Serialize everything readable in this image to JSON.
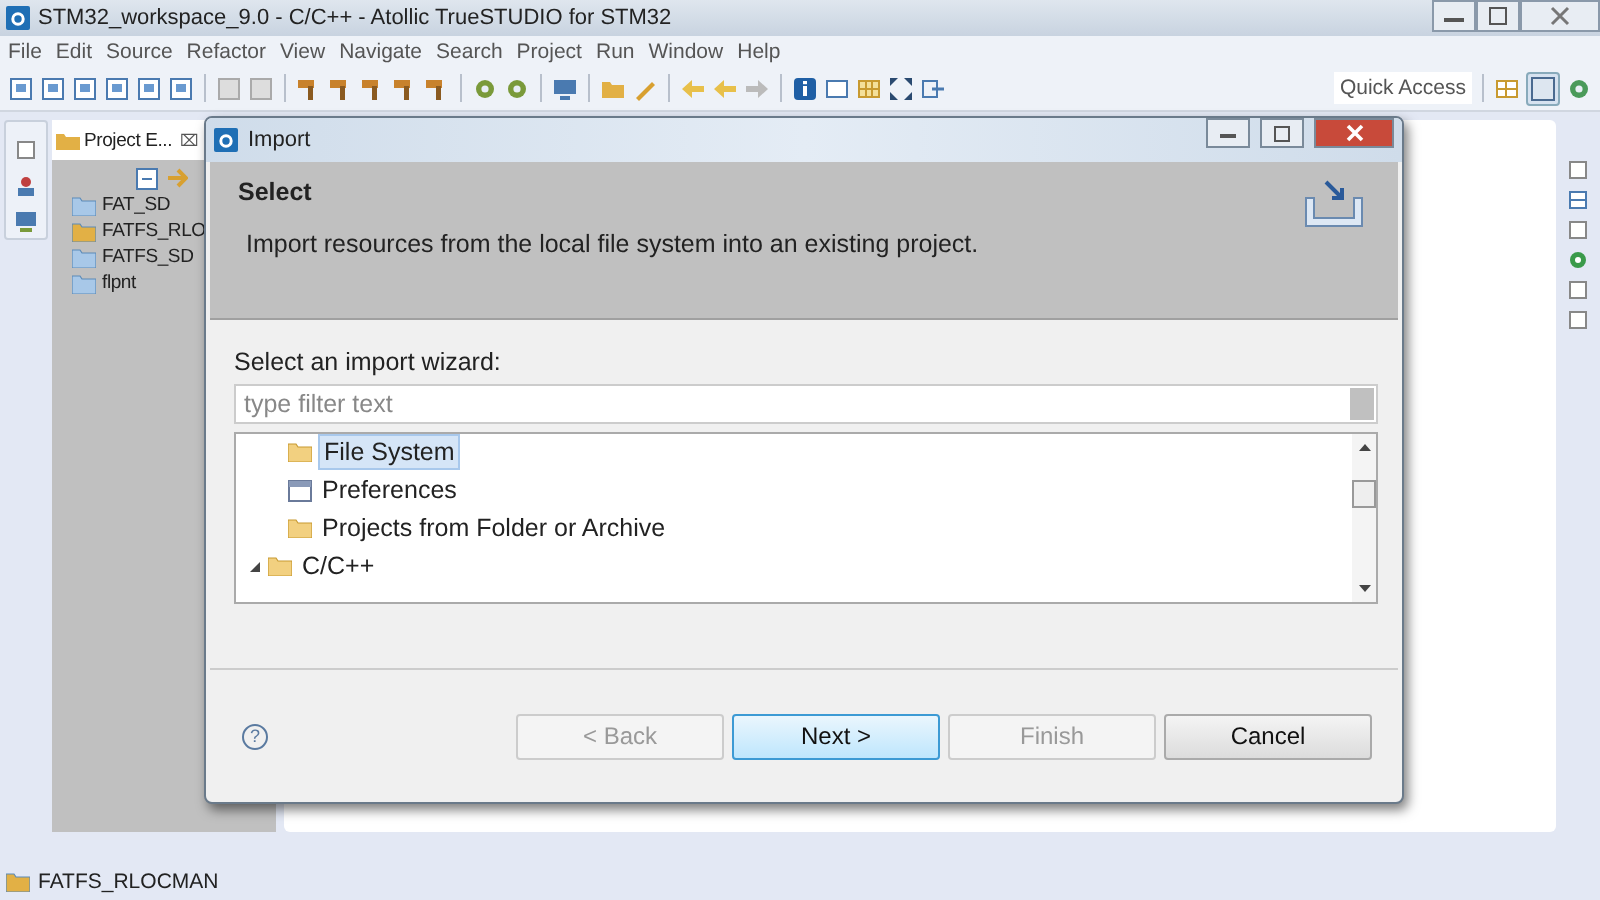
{
  "window": {
    "title": "STM32_workspace_9.0 - C/C++ - Atollic TrueSTUDIO for STM32"
  },
  "menu": [
    "File",
    "Edit",
    "Source",
    "Refactor",
    "View",
    "Navigate",
    "Search",
    "Project",
    "Run",
    "Window",
    "Help"
  ],
  "quick_access": {
    "placeholder": "Quick Access"
  },
  "project_explorer": {
    "title": "Project E...",
    "close": "⌧",
    "items": [
      {
        "label": "FAT_SD",
        "kind": "folder"
      },
      {
        "label": "FATFS_RLO",
        "kind": "project"
      },
      {
        "label": "FATFS_SD",
        "kind": "folder"
      },
      {
        "label": "flpnt",
        "kind": "folder"
      }
    ]
  },
  "dialog": {
    "title": "Import",
    "heading": "Select",
    "description": "Import resources from the local file system into an existing project.",
    "wizard_label": "Select an import wizard:",
    "filter": {
      "placeholder": "type filter text"
    },
    "wizards": [
      {
        "label": "File System",
        "kind": "leaf",
        "selected": true
      },
      {
        "label": "Preferences",
        "kind": "prefs",
        "selected": false
      },
      {
        "label": "Projects from Folder or Archive",
        "kind": "leaf",
        "selected": false
      },
      {
        "label": "C/C++",
        "kind": "group",
        "selected": false,
        "expanded": true
      }
    ],
    "help": "?",
    "buttons": [
      {
        "label": "< Back",
        "disabled": true,
        "default": false
      },
      {
        "label": "Next >",
        "disabled": false,
        "default": true
      },
      {
        "label": "Finish",
        "disabled": true,
        "default": false
      },
      {
        "label": "Cancel",
        "disabled": false,
        "default": false
      }
    ]
  },
  "status_bar": {
    "text": "FATFS_RLOCMAN"
  }
}
